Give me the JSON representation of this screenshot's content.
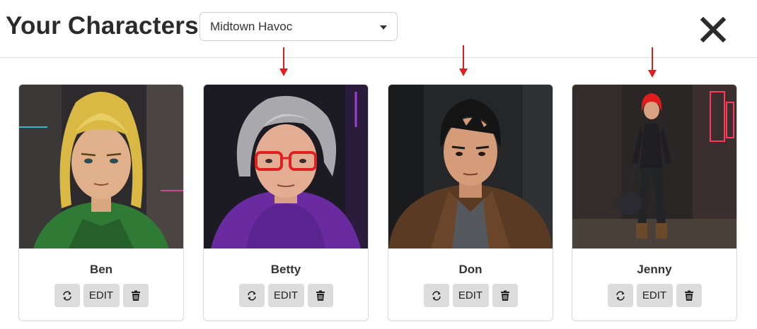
{
  "header": {
    "title": "Your Characters",
    "selected_world": "Midtown Havoc"
  },
  "colors": {
    "arrow": "#e01e1e",
    "button_bg": "#dcdcdc"
  },
  "icons": {
    "close": "close-icon",
    "regenerate": "refresh-icon",
    "delete": "trash-icon",
    "select_caret": "caret-down-icon"
  },
  "characters": [
    {
      "name": "Ben",
      "edit_label": "EDIT",
      "hair": "#d9b843",
      "clothes": "#2f7a35"
    },
    {
      "name": "Betty",
      "edit_label": "EDIT",
      "hair": "#a9a9ad",
      "clothes": "#6a2ba0"
    },
    {
      "name": "Don",
      "edit_label": "EDIT",
      "hair": "#141414",
      "clothes": "#5a3a22"
    },
    {
      "name": "Jenny",
      "edit_label": "EDIT",
      "hair": "#e21b1b",
      "clothes": "#1e1e22"
    }
  ]
}
